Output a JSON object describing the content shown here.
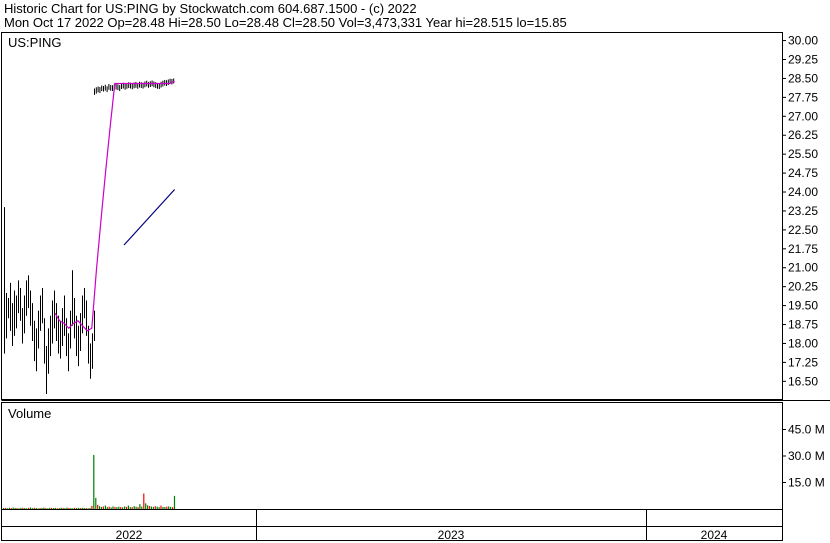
{
  "header": {
    "line1": "Historic Chart for US:PING by Stockwatch.com 604.687.1500 - (c) 2022",
    "line2": "Mon Oct 17 2022   Op=28.48  Hi=28.50  Lo=28.48  Cl=28.50  Vol=3,473,331  Year hi=28.515  lo=15.85"
  },
  "chart_data": {
    "type": "line",
    "title": "Historic Chart for US:PING",
    "symbol_label": "US:PING",
    "price_axis": {
      "ticks": [
        "30.00",
        "29.25",
        "28.50",
        "27.75",
        "27.00",
        "26.25",
        "25.50",
        "24.75",
        "24.00",
        "23.25",
        "22.50",
        "21.75",
        "21.00",
        "20.25",
        "19.50",
        "18.75",
        "18.00",
        "17.25",
        "16.50"
      ],
      "ylim": [
        15.8,
        30.3
      ]
    },
    "volume_panel_label": "Volume",
    "volume_axis": {
      "ticks": [
        "45.0 M",
        "30.0 M",
        "15.0 M"
      ],
      "ylim": [
        0,
        60
      ]
    },
    "x_axis": {
      "years": [
        "2022",
        "2023",
        "2024"
      ],
      "years_spanned": [
        1,
        2,
        1
      ]
    },
    "price_bars_early": {
      "lows": [
        17.6,
        18.2,
        19.0,
        18.5,
        17.9,
        18.3,
        18.6,
        19.2,
        18.9,
        18.0,
        18.4,
        19.1,
        19.4,
        18.7,
        18.1,
        17.3,
        16.9,
        17.8,
        18.5,
        18.8,
        17.2,
        16.0,
        16.8,
        17.5,
        18.0,
        18.6,
        18.1,
        17.6,
        17.4,
        17.9,
        18.3,
        17.5,
        16.9,
        17.8,
        18.7,
        18.2,
        17.5,
        17.1,
        17.7,
        18.4,
        19.0,
        18.3,
        17.2,
        16.6,
        17.0,
        18.1
      ],
      "highs": [
        23.4,
        20.0,
        19.8,
        20.4,
        19.6,
        20.1,
        19.9,
        20.5,
        20.2,
        19.4,
        19.9,
        20.5,
        20.7,
        20.1,
        19.6,
        18.9,
        18.6,
        19.3,
        19.9,
        20.2,
        19.0,
        17.9,
        18.6,
        19.1,
        19.7,
        20.1,
        19.6,
        19.1,
        18.9,
        19.4,
        19.9,
        19.0,
        18.4,
        19.3,
        20.9,
        19.8,
        19.1,
        18.7,
        19.2,
        19.9,
        20.2,
        19.7,
        18.7,
        18.0,
        18.4,
        19.3
      ]
    },
    "price_bars_late": {
      "lows": [
        27.85,
        27.9,
        27.95,
        27.92,
        28.0,
        27.98,
        28.02,
        27.96,
        28.05,
        28.01,
        28.0,
        28.03,
        28.06,
        28.04,
        28.0,
        28.08,
        28.1,
        28.05,
        28.09,
        28.12,
        28.1,
        28.07,
        28.11,
        28.13,
        28.09,
        28.14,
        28.12,
        28.1,
        28.15,
        28.18,
        28.13,
        28.16,
        28.19,
        28.15,
        28.12,
        28.09,
        28.08,
        28.14,
        28.18,
        28.22,
        28.2,
        28.24,
        28.28,
        28.26,
        28.3
      ],
      "highs": [
        28.1,
        28.15,
        28.18,
        28.16,
        28.22,
        28.2,
        28.25,
        28.19,
        28.28,
        28.24,
        28.23,
        28.26,
        28.29,
        28.27,
        28.24,
        28.31,
        28.33,
        28.28,
        28.32,
        28.35,
        28.33,
        28.3,
        28.34,
        28.36,
        28.32,
        28.37,
        28.35,
        28.33,
        28.38,
        28.41,
        28.36,
        28.39,
        28.42,
        28.38,
        28.35,
        28.32,
        28.31,
        28.37,
        28.41,
        28.44,
        28.43,
        28.46,
        28.49,
        28.48,
        28.5
      ]
    },
    "series": [
      {
        "color": "#cc00cc",
        "x": [
          0,
          5,
          10,
          15,
          20,
          25,
          30,
          35,
          40,
          45,
          50,
          55,
          60,
          65,
          70,
          75,
          80,
          85,
          90,
          95,
          100,
          105,
          110,
          115,
          120,
          125,
          130
        ],
        "values": [
          19.2,
          18.9,
          18.8,
          18.6,
          18.8,
          18.9,
          18.7,
          18.5,
          18.6,
          20.9,
          22.9,
          24.8,
          26.6,
          28.3,
          28.3,
          28.3,
          28.3,
          28.3,
          28.3,
          28.3,
          28.3,
          28.3,
          28.3,
          28.3,
          28.3,
          28.3,
          28.4
        ]
      },
      {
        "color": "#000080",
        "x": [
          75,
          130
        ],
        "values": [
          21.9,
          24.1
        ]
      }
    ],
    "volume": {
      "values": [
        0.5,
        0.6,
        0.4,
        0.7,
        0.5,
        0.8,
        0.6,
        0.5,
        0.4,
        0.6,
        0.7,
        0.5,
        0.4,
        0.6,
        0.9,
        0.5,
        0.7,
        0.6,
        0.4,
        0.5,
        0.6,
        0.8,
        0.5,
        0.4,
        0.7,
        0.6,
        0.5,
        0.6,
        0.4,
        0.5,
        0.7,
        0.6,
        0.5,
        0.8,
        0.6,
        0.5,
        0.4,
        0.7,
        0.5,
        0.6,
        0.5,
        0.7,
        0.6,
        0.5,
        0.4,
        0.6,
        1.8,
        30.6,
        6.3,
        2.4,
        1.6,
        1.2,
        1.4,
        2.0,
        1.1,
        1.3,
        0.9,
        1.5,
        1.2,
        1.0,
        1.3,
        1.1,
        0.9,
        1.4,
        1.2,
        2.0,
        1.1,
        1.0,
        1.6,
        1.3,
        1.1,
        2.8,
        1.4,
        8.8,
        3.2,
        2.1,
        1.7,
        1.4,
        1.2,
        1.6,
        1.3,
        1.0,
        1.9,
        1.2,
        1.1,
        1.3,
        1.5,
        1.2,
        1.0,
        7.4
      ],
      "colors_legend": [
        "red",
        "green"
      ]
    }
  }
}
